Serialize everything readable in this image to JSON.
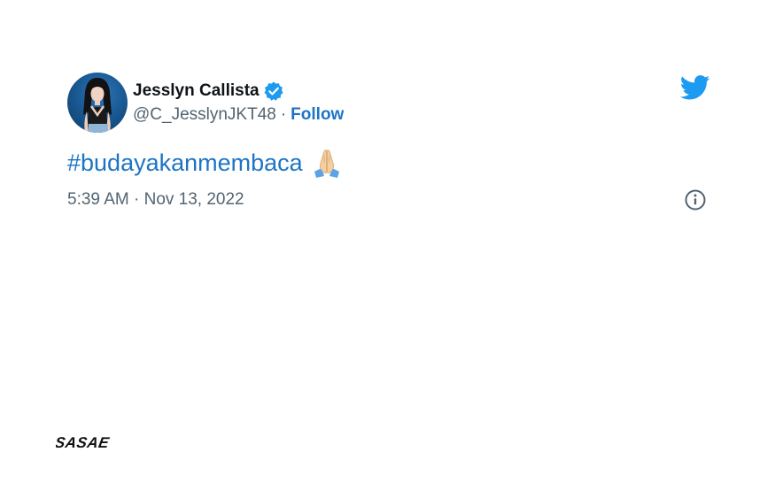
{
  "tweet": {
    "author": {
      "display_name": "Jesslyn Callista",
      "handle": "@C_JesslynJKT48",
      "verified": true
    },
    "separator": "·",
    "follow_label": "Follow",
    "text": {
      "hashtag": "#budayakanmembaca",
      "emoji": "folded-hands-icon"
    },
    "timestamp": "5:39 AM · Nov 13, 2022"
  },
  "icons": {
    "platform": "twitter-bird-icon",
    "verified": "verified-badge-icon",
    "info": "info-icon"
  },
  "colors": {
    "link": "#1d74c4",
    "name": "#0f1419",
    "secondary": "#536471",
    "twitter_blue": "#1d9bf0"
  },
  "brand": {
    "logo_text": "SASAE"
  }
}
